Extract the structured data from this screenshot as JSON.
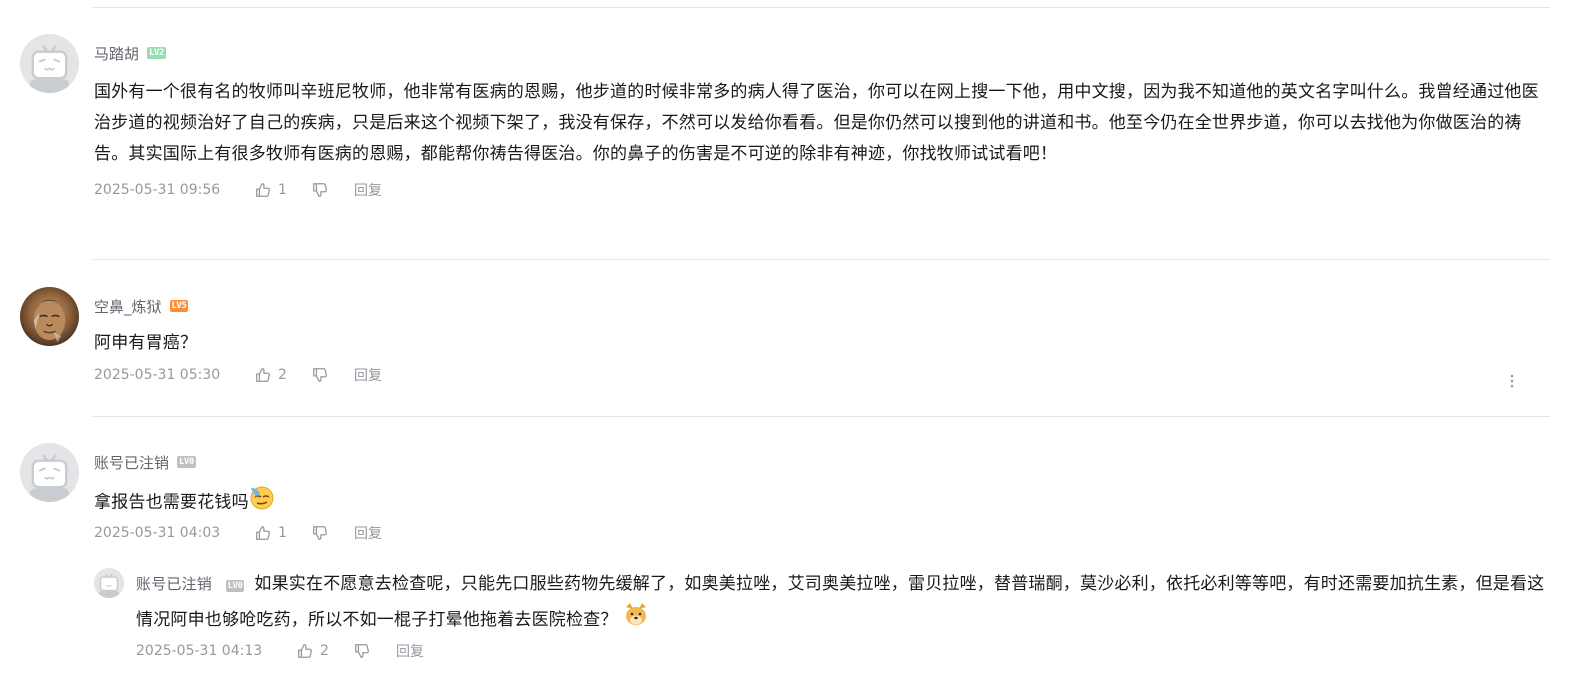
{
  "actions": {
    "reply_label": "回复"
  },
  "comments": [
    {
      "username": "马踏胡",
      "level": "LV2",
      "text": "国外有一个很有名的牧师叫辛班尼牧师，他非常有医病的恩赐，他步道的时候非常多的病人得了医治，你可以在网上搜一下他，用中文搜，因为我不知道他的英文名字叫什么。我曾经通过他医治步道的视频治好了自己的疾病，只是后来这个视频下架了，我没有保存，不然可以发给你看看。但是你仍然可以搜到他的讲道和书。他至今仍在全世界步道，你可以去找他为你做医治的祷告。其实国际上有很多牧师有医病的恩赐，都能帮你祷告得医治。你的鼻子的伤害是不可逆的除非有神迹，你找牧师试试看吧！",
      "time": "2025-05-31 09:56",
      "likes": "1"
    },
    {
      "username": "空鼻_炼狱",
      "level": "LV5",
      "text": "阿申有胃癌？",
      "time": "2025-05-31 05:30",
      "likes": "2"
    },
    {
      "username": "账号已注销",
      "level": "LV0",
      "text": "拿报告也需要花钱吗",
      "time": "2025-05-31 04:03",
      "likes": "1",
      "reply": {
        "username": "账号已注销",
        "level": "LV0",
        "text": "如果实在不愿意去检查呢，只能先口服些药物先缓解了，如奥美拉唑，艾司奥美拉唑，雷贝拉唑，替普瑞酮，莫沙必利，依托必利等等吧，有时还需要加抗生素，但是看这情况阿申也够呛吃药，所以不如一棍子打晕他拖着去医院检查？",
        "time": "2025-05-31 04:13",
        "likes": "2"
      }
    }
  ]
}
